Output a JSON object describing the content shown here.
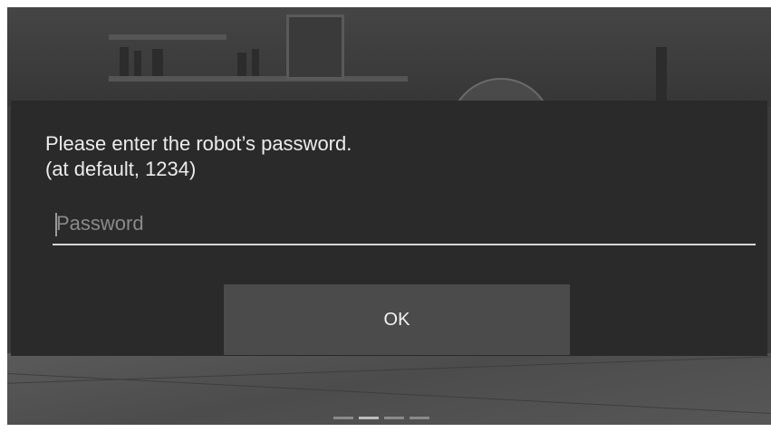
{
  "dialog": {
    "message_line1": "Please enter the robot’s password.",
    "message_line2": "(at default, 1234)",
    "password_placeholder": "Password",
    "password_value": "",
    "ok_label": "OK"
  },
  "pager": {
    "page_count": 4,
    "current_page": 2
  },
  "colors": {
    "dialog_bg": "#2a2a2a",
    "button_bg": "#4b4b4b",
    "text": "#ececec"
  }
}
